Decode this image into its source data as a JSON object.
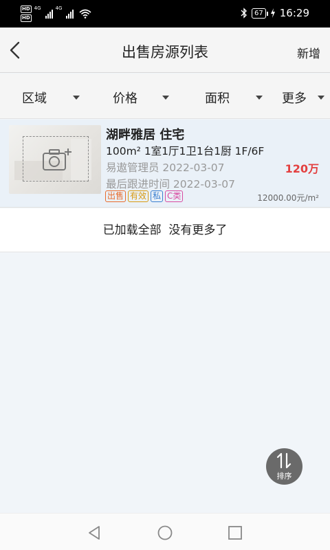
{
  "status_bar": {
    "hd1": "HD",
    "hd2": "HD",
    "net1": "4G",
    "net2": "4G",
    "battery": "67",
    "time": "16:29"
  },
  "navbar": {
    "title": "出售房源列表",
    "add_label": "新增"
  },
  "filters": [
    {
      "label": "区域"
    },
    {
      "label": "价格"
    },
    {
      "label": "面积"
    },
    {
      "label": "更多"
    }
  ],
  "listings": [
    {
      "name": "湖畔雅居 住宅",
      "spec": "100m² 1室1厅1卫1台1厨 1F/6F",
      "manager": "易遨管理员 2022-03-07",
      "followup": "最后跟进时间 2022-03-07",
      "price": "120万",
      "unit_price": "12000.00元/m²",
      "tags": [
        "出售",
        "有效",
        "私",
        "C类"
      ]
    }
  ],
  "load_more": "已加载全部  没有更多了",
  "sort_fab": {
    "label": "排序"
  },
  "colors": {
    "price": "#e34040",
    "tag_sale": "#e86a2a",
    "tag_valid": "#d89a10",
    "tag_private": "#3a7fd0",
    "tag_class": "#d84aa0"
  }
}
